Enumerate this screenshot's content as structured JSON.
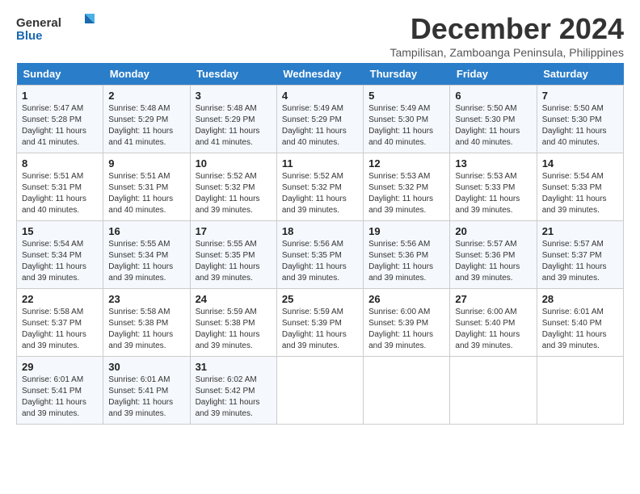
{
  "header": {
    "logo_general": "General",
    "logo_blue": "Blue",
    "month_title": "December 2024",
    "location": "Tampilisan, Zamboanga Peninsula, Philippines"
  },
  "days_of_week": [
    "Sunday",
    "Monday",
    "Tuesday",
    "Wednesday",
    "Thursday",
    "Friday",
    "Saturday"
  ],
  "weeks": [
    [
      {
        "day": "1",
        "sunrise": "5:47 AM",
        "sunset": "5:28 PM",
        "daylight": "11 hours and 41 minutes."
      },
      {
        "day": "2",
        "sunrise": "5:48 AM",
        "sunset": "5:29 PM",
        "daylight": "11 hours and 41 minutes."
      },
      {
        "day": "3",
        "sunrise": "5:48 AM",
        "sunset": "5:29 PM",
        "daylight": "11 hours and 41 minutes."
      },
      {
        "day": "4",
        "sunrise": "5:49 AM",
        "sunset": "5:29 PM",
        "daylight": "11 hours and 40 minutes."
      },
      {
        "day": "5",
        "sunrise": "5:49 AM",
        "sunset": "5:30 PM",
        "daylight": "11 hours and 40 minutes."
      },
      {
        "day": "6",
        "sunrise": "5:50 AM",
        "sunset": "5:30 PM",
        "daylight": "11 hours and 40 minutes."
      },
      {
        "day": "7",
        "sunrise": "5:50 AM",
        "sunset": "5:30 PM",
        "daylight": "11 hours and 40 minutes."
      }
    ],
    [
      {
        "day": "8",
        "sunrise": "5:51 AM",
        "sunset": "5:31 PM",
        "daylight": "11 hours and 40 minutes."
      },
      {
        "day": "9",
        "sunrise": "5:51 AM",
        "sunset": "5:31 PM",
        "daylight": "11 hours and 40 minutes."
      },
      {
        "day": "10",
        "sunrise": "5:52 AM",
        "sunset": "5:32 PM",
        "daylight": "11 hours and 39 minutes."
      },
      {
        "day": "11",
        "sunrise": "5:52 AM",
        "sunset": "5:32 PM",
        "daylight": "11 hours and 39 minutes."
      },
      {
        "day": "12",
        "sunrise": "5:53 AM",
        "sunset": "5:32 PM",
        "daylight": "11 hours and 39 minutes."
      },
      {
        "day": "13",
        "sunrise": "5:53 AM",
        "sunset": "5:33 PM",
        "daylight": "11 hours and 39 minutes."
      },
      {
        "day": "14",
        "sunrise": "5:54 AM",
        "sunset": "5:33 PM",
        "daylight": "11 hours and 39 minutes."
      }
    ],
    [
      {
        "day": "15",
        "sunrise": "5:54 AM",
        "sunset": "5:34 PM",
        "daylight": "11 hours and 39 minutes."
      },
      {
        "day": "16",
        "sunrise": "5:55 AM",
        "sunset": "5:34 PM",
        "daylight": "11 hours and 39 minutes."
      },
      {
        "day": "17",
        "sunrise": "5:55 AM",
        "sunset": "5:35 PM",
        "daylight": "11 hours and 39 minutes."
      },
      {
        "day": "18",
        "sunrise": "5:56 AM",
        "sunset": "5:35 PM",
        "daylight": "11 hours and 39 minutes."
      },
      {
        "day": "19",
        "sunrise": "5:56 AM",
        "sunset": "5:36 PM",
        "daylight": "11 hours and 39 minutes."
      },
      {
        "day": "20",
        "sunrise": "5:57 AM",
        "sunset": "5:36 PM",
        "daylight": "11 hours and 39 minutes."
      },
      {
        "day": "21",
        "sunrise": "5:57 AM",
        "sunset": "5:37 PM",
        "daylight": "11 hours and 39 minutes."
      }
    ],
    [
      {
        "day": "22",
        "sunrise": "5:58 AM",
        "sunset": "5:37 PM",
        "daylight": "11 hours and 39 minutes."
      },
      {
        "day": "23",
        "sunrise": "5:58 AM",
        "sunset": "5:38 PM",
        "daylight": "11 hours and 39 minutes."
      },
      {
        "day": "24",
        "sunrise": "5:59 AM",
        "sunset": "5:38 PM",
        "daylight": "11 hours and 39 minutes."
      },
      {
        "day": "25",
        "sunrise": "5:59 AM",
        "sunset": "5:39 PM",
        "daylight": "11 hours and 39 minutes."
      },
      {
        "day": "26",
        "sunrise": "6:00 AM",
        "sunset": "5:39 PM",
        "daylight": "11 hours and 39 minutes."
      },
      {
        "day": "27",
        "sunrise": "6:00 AM",
        "sunset": "5:40 PM",
        "daylight": "11 hours and 39 minutes."
      },
      {
        "day": "28",
        "sunrise": "6:01 AM",
        "sunset": "5:40 PM",
        "daylight": "11 hours and 39 minutes."
      }
    ],
    [
      {
        "day": "29",
        "sunrise": "6:01 AM",
        "sunset": "5:41 PM",
        "daylight": "11 hours and 39 minutes."
      },
      {
        "day": "30",
        "sunrise": "6:01 AM",
        "sunset": "5:41 PM",
        "daylight": "11 hours and 39 minutes."
      },
      {
        "day": "31",
        "sunrise": "6:02 AM",
        "sunset": "5:42 PM",
        "daylight": "11 hours and 39 minutes."
      },
      null,
      null,
      null,
      null
    ]
  ],
  "labels": {
    "sunrise": "Sunrise:",
    "sunset": "Sunset:",
    "daylight": "Daylight:"
  }
}
